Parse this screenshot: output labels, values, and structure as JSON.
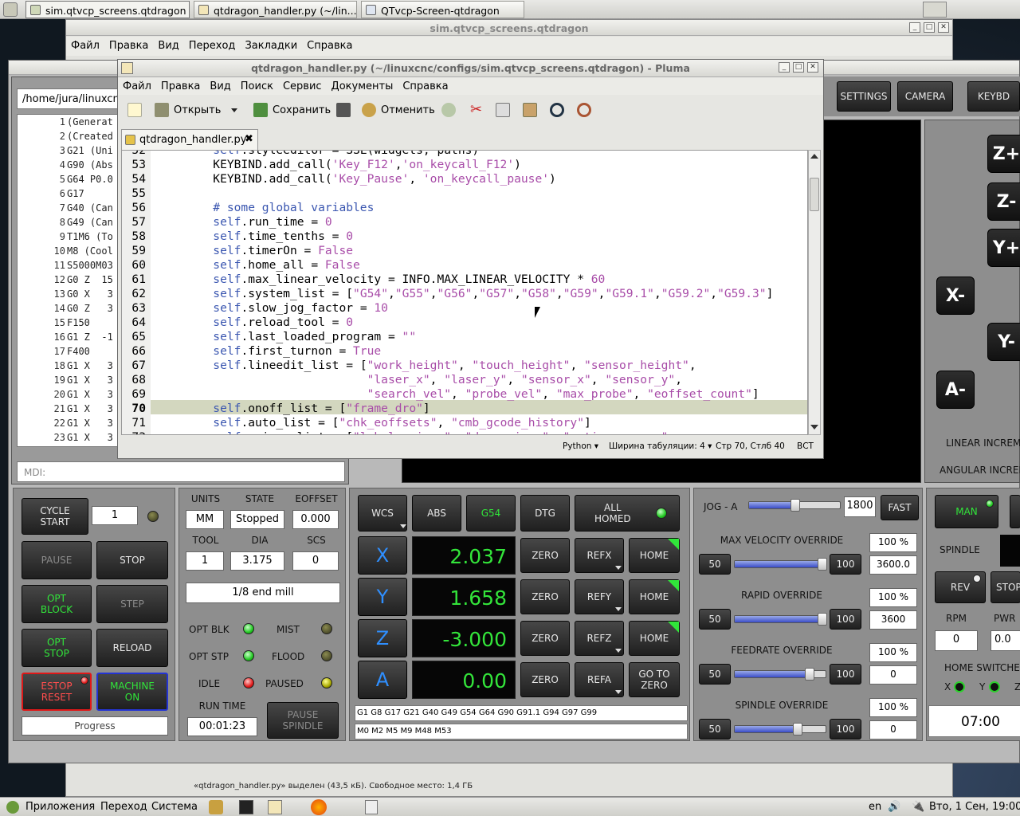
{
  "top_panel": {
    "tasks": [
      "sim.qtvcp_screens.qtdragon",
      "qtdragon_handler.py (~/lin...",
      "QTvcp-Screen-qtdragon"
    ]
  },
  "filemanager": {
    "title": "sim.qtvcp_screens.qtdragon",
    "menu": [
      "Файл",
      "Правка",
      "Вид",
      "Переход",
      "Закладки",
      "Справка"
    ],
    "status": "«qtdragon_handler.py» выделен (43,5 кБ). Свободное место: 1,4 ГБ"
  },
  "gui": {
    "path": "/home/jura/linuxcnc",
    "gcode_lines": [
      {
        "n": "1",
        "t": "(Generat"
      },
      {
        "n": "2",
        "t": "(Created"
      },
      {
        "n": "3",
        "t": "G21 (Uni"
      },
      {
        "n": "4",
        "t": "G90 (Abs"
      },
      {
        "n": "5",
        "t": "G64 P0.0"
      },
      {
        "n": "6",
        "t": "G17"
      },
      {
        "n": "7",
        "t": "G40 (Can"
      },
      {
        "n": "8",
        "t": "G49 (Can"
      },
      {
        "n": "9",
        "t": "T1M6 (To"
      },
      {
        "n": "10",
        "t": "M8 (Cool"
      },
      {
        "n": "11",
        "t": "S5000M03"
      },
      {
        "n": "12",
        "t": "G0 Z  15"
      },
      {
        "n": "13",
        "t": "G0 X   3"
      },
      {
        "n": "14",
        "t": "G0 Z   3"
      },
      {
        "n": "15",
        "t": "F150"
      },
      {
        "n": "16",
        "t": "G1 Z  -1"
      },
      {
        "n": "17",
        "t": "F400"
      },
      {
        "n": "18",
        "t": "G1 X   3"
      },
      {
        "n": "19",
        "t": "G1 X   3"
      },
      {
        "n": "20",
        "t": "G1 X   3"
      },
      {
        "n": "21",
        "t": "G1 X   3"
      },
      {
        "n": "22",
        "t": "G1 X   3"
      },
      {
        "n": "23",
        "t": "G1 X   3"
      }
    ],
    "mdi_placeholder": "MDI:",
    "top_buttons": [
      "SETTINGS",
      "CAMERA",
      "KEYBD"
    ],
    "jog_labels": [
      "Z+",
      "Z-",
      "Y+",
      "X-",
      "Y-",
      "A-"
    ],
    "linear_increment": "LINEAR INCREM",
    "angular_increment": "ANGULAR INCREM",
    "cycle_start": "CYCLE\nSTART",
    "cycle_start_value": "1",
    "pause": "PAUSE",
    "stop": "STOP",
    "opt_block": "OPT\nBLOCK",
    "step": "STEP",
    "opt_stop": "OPT\nSTOP",
    "reload": "RELOAD",
    "estop_reset": "ESTOP\nRESET",
    "machine_on": "MACHINE\nON",
    "progress": "Progress",
    "units_label": "UNITS",
    "units_value": "MM",
    "state_label": "STATE",
    "state_value": "Stopped",
    "eoffset_label": "EOFFSET",
    "eoffset_value": "0.000",
    "tool_label": "TOOL",
    "tool_value": "1",
    "dia_label": "DIA",
    "dia_value": "3.175",
    "scs_label": "SCS",
    "scs_value": "0",
    "tool_desc": "1/8 end mill",
    "opt_blk_label": "OPT BLK",
    "mist_label": "MIST",
    "opt_stp_label": "OPT STP",
    "flood_label": "FLOOD",
    "idle_label": "IDLE",
    "paused_label": "PAUSED",
    "run_time_label": "RUN TIME",
    "run_time_value": "00:01:23",
    "pause_spindle": "PAUSE\nSPINDLE",
    "dro_header": [
      "WCS",
      "ABS",
      "G54",
      "DTG"
    ],
    "all_homed": "ALL\nHOMED",
    "axes": [
      {
        "name": "X",
        "value": "2.037",
        "ref": "REFX",
        "home": "HOME"
      },
      {
        "name": "Y",
        "value": "1.658",
        "ref": "REFY",
        "home": "HOME"
      },
      {
        "name": "Z",
        "value": "-3.000",
        "ref": "REFZ",
        "home": "HOME"
      },
      {
        "name": "A",
        "value": "0.00",
        "ref": "REFA",
        "home": "GO TO\nZERO"
      }
    ],
    "zero_label": "ZERO",
    "gcodes": "G1 G8 G17 G21 G40 G49 G54 G64 G90 G91.1 G94 G97 G99",
    "mcodes": "M0 M2 M5 M9 M48 M53",
    "jog_label": "JOG - A",
    "jog_value": "1800",
    "jog_level": 0.5,
    "fast": "FAST",
    "overrides": [
      {
        "name": "MAX VELOCITY OVERRIDE",
        "pct": "100 %",
        "val": "3600.0",
        "level": 1.0
      },
      {
        "name": "RAPID OVERRIDE",
        "pct": "100 %",
        "val": "3600",
        "level": 1.0
      },
      {
        "name": "FEEDRATE OVERRIDE",
        "pct": "100 %",
        "val": "0",
        "level": 0.85
      },
      {
        "name": "SPINDLE OVERRIDE",
        "pct": "100 %",
        "val": "0",
        "level": 0.7
      }
    ],
    "ov_min": "50",
    "ov_max": "100",
    "man": "MAN",
    "spindle": "SPINDLE",
    "rev": "REV",
    "stop_cut": "STOP",
    "rpm_label": "RPM",
    "rpm_value": "0",
    "pwr_label": "PWR",
    "pwr_value": "0.0",
    "home_switches": "HOME SWITCHE",
    "hs_x": "X",
    "hs_y": "Y",
    "hs_z": "Z",
    "clock": "07:00"
  },
  "pluma": {
    "title": "qtdragon_handler.py (~/linuxcnc/configs/sim.qtvcp_screens.qtdragon) - Pluma",
    "menu": [
      "Файл",
      "Правка",
      "Вид",
      "Поиск",
      "Сервис",
      "Документы",
      "Справка"
    ],
    "open": "Открыть",
    "save": "Сохранить",
    "undo": "Отменить",
    "tab": "qtdragon_handler.py",
    "lang": "Python",
    "tab_width_label": "Ширина табуляции:",
    "tab_width": "4",
    "position": "Стр 70, Стлб 40",
    "mode": "ВСТ"
  },
  "bottom_panel": {
    "apps": "Приложения",
    "goto": "Переход",
    "system": "Система",
    "lang": "en",
    "datetime": "Втo,  1 Сен, 19:00"
  },
  "colors": {
    "dro_green": "#33e43a",
    "axis_blue": "#2f8fff",
    "estop_red": "#e01818"
  }
}
